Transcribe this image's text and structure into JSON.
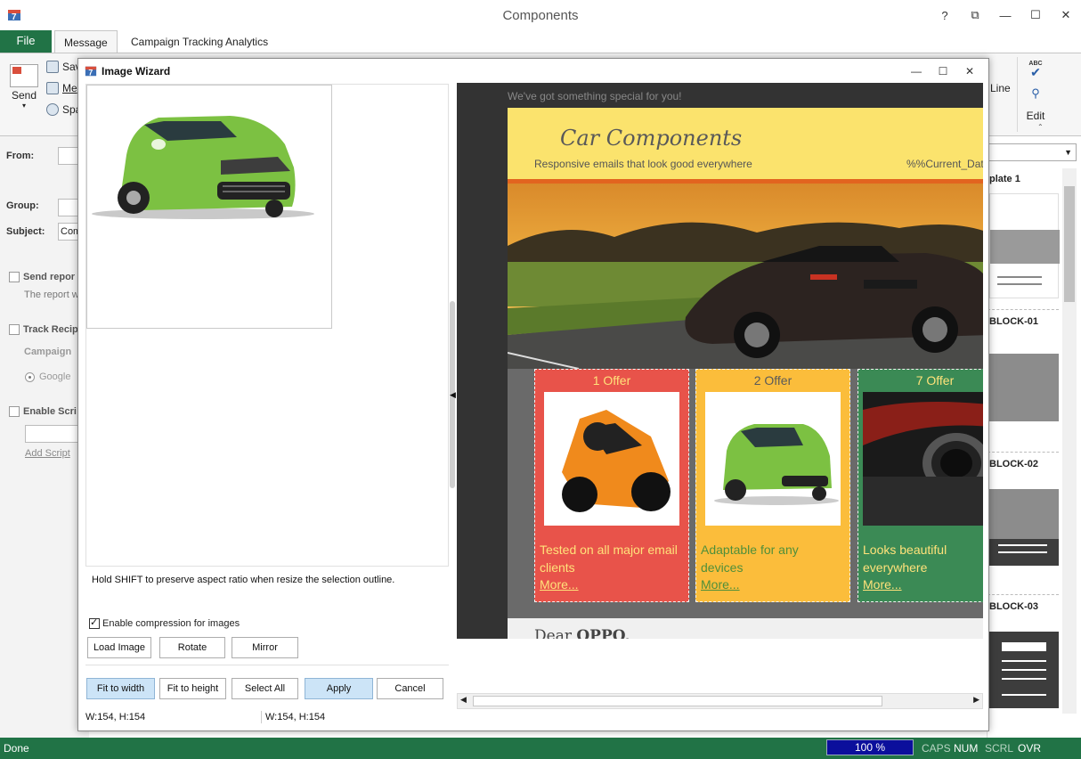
{
  "app": {
    "title": "Components"
  },
  "window_controls": [
    "?",
    "⧉",
    "—",
    "☐",
    "✕"
  ],
  "ribbon_tabs": [
    {
      "label": "File"
    },
    {
      "label": "Message"
    },
    {
      "label": "Campaign Tracking Analytics"
    }
  ],
  "ribbon": {
    "send": "Send",
    "small": [
      "Sav",
      "Me",
      "Spa"
    ],
    "line": "Line",
    "edit": "Edit",
    "abc": "ABC"
  },
  "form": {
    "from": "From:",
    "group": "Group:",
    "subject": "Subject:",
    "subject_value": "Com",
    "send_report": "Send repor",
    "report_text": "The report w",
    "track": "Track Recip",
    "campaign": "Campaign",
    "google": "Google",
    "enable_script": "Enable Scri",
    "add_script": "Add Script"
  },
  "templates": {
    "items": [
      {
        "title": "plate 1"
      },
      {
        "title": "BLOCK-01"
      },
      {
        "title": "BLOCK-02"
      },
      {
        "title": "BLOCK-03"
      }
    ]
  },
  "status": {
    "done": "Done",
    "zoom": "100 %",
    "keys": [
      {
        "label": "CAPS",
        "on": false
      },
      {
        "label": "NUM",
        "on": true
      },
      {
        "label": "SCRL",
        "on": false
      },
      {
        "label": "OVR",
        "on": true
      }
    ]
  },
  "dialog": {
    "title": "Image Wizard",
    "controls": [
      "—",
      "☐",
      "✕"
    ],
    "hint": "Hold SHIFT to preserve aspect ratio when resize the selection outline.",
    "compression_label": "Enable compression for images",
    "compression_checked": true,
    "buttons": {
      "load": "Load Image",
      "rotate": "Rotate",
      "mirror": "Mirror",
      "fit_width": "Fit to width",
      "fit_height": "Fit to height",
      "select_all": "Select All",
      "apply": "Apply",
      "cancel": "Cancel"
    },
    "status_left": "W:154, H:154",
    "status_right": "W:154, H:154"
  },
  "preview": {
    "top_text": "We've got something special for you!",
    "title": "Car Components",
    "subtitle": "Responsive emails that look good everywhere",
    "date": "%%Current_Date",
    "offers": [
      {
        "title": "1 Offer",
        "text": "Tested on all major email clients",
        "more": "More...",
        "bg": "#e8534a",
        "title_color": "#ffe27a",
        "text_color": "#ffe27a"
      },
      {
        "title": "2 Offer",
        "text": "Adaptable for any devices",
        "more": "More...",
        "bg": "#fbbd3b",
        "title_color": "#5a5a5a",
        "text_color": "#4f8f3a"
      },
      {
        "title": "7 Offer",
        "text": "Looks beautiful everywhere",
        "more": "More...",
        "bg": "#3b8a55",
        "title_color": "#ffe27a",
        "text_color": "#ffe27a"
      }
    ],
    "dear": "Dear",
    "dear_name": "OPPO,"
  },
  "colors": {
    "accent_green": "#217346",
    "button_primary": "#cce4f7",
    "header_yellow": "#fbe36d",
    "stripe_orange": "#e2641f"
  }
}
